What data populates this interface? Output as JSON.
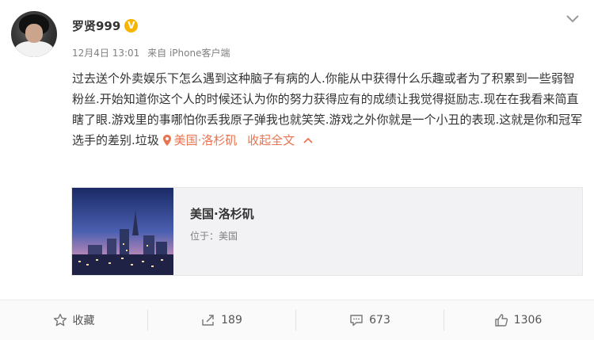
{
  "post": {
    "username": "罗贤999",
    "badge": "V",
    "date": "12月4日 13:01",
    "source": "来自 iPhone客户端",
    "body_text": "过去送个外卖娱乐下怎么遇到这种脑子有病的人.你能从中获得什么乐趣或者为了积累到一些弱智粉丝.开始知道你这个人的时候还认为你的努力获得应有的成绩让我觉得挺励志.现在在我看来简直瞎了眼.游戏里的事哪怕你丢我原子弹我也就笑笑.游戏之外你就是一个小丑的表现.这就是你和冠军选手的差别.垃圾",
    "location_link": "美国·洛杉矶",
    "collapse_label": "收起全文",
    "collapse_arrow": "^"
  },
  "location_card": {
    "title": "美国·洛杉矶",
    "subtitle": "位于：美国"
  },
  "toolbar": {
    "favorite_label": "收藏",
    "repost_count": "189",
    "comment_count": "673",
    "like_count": "1306"
  },
  "colors": {
    "accent": "#eb7350",
    "badge": "#f7b500",
    "muted": "#808080"
  }
}
